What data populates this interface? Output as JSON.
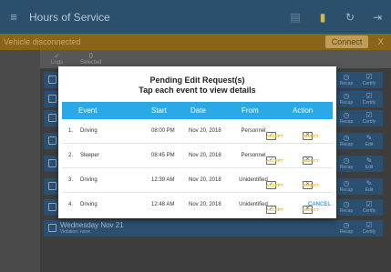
{
  "appbar": {
    "title": "Hours of Service",
    "menu_icon": "menu-icon"
  },
  "banner": {
    "text": "Vehicle disconnected",
    "connect_label": "Connect",
    "close_label": "X"
  },
  "toolbar": {
    "items": [
      {
        "icon": "✓",
        "label": "Logs"
      },
      {
        "icon": "0",
        "label": "Selected"
      }
    ]
  },
  "days": [
    {
      "title": "Wednesday Nov 21",
      "violation": "Violation: none"
    }
  ],
  "row_buttons": {
    "recap": "Recap",
    "certify": "Certify",
    "edit": "Edit"
  },
  "modal": {
    "title": "Pending Edit Request(s)",
    "subtitle": "Tap each event to view details",
    "columns": [
      "Event",
      "Start",
      "Date",
      "From",
      "Action"
    ],
    "rows": [
      {
        "num": "1.",
        "event": "Driving",
        "start": "08:00 PM",
        "date": "Nov 20, 2018",
        "from": "Personnel"
      },
      {
        "num": "2.",
        "event": "Sleeper",
        "start": "08:45 PM",
        "date": "Nov 20, 2018",
        "from": "Personnel"
      },
      {
        "num": "3.",
        "event": "Driving",
        "start": "12:39 AM",
        "date": "Nov 20, 2018",
        "from": "Unidentified"
      },
      {
        "num": "4.",
        "event": "Driving",
        "start": "12:48 AM",
        "date": "Nov 20, 2018",
        "from": "Unidentified"
      }
    ],
    "accept_label": "ACCEPT",
    "reject_label": "REJECT",
    "cancel_label": "CANCEL"
  },
  "colors": {
    "appbar": "#2c4f6c",
    "banner": "#8a6418",
    "header": "#29a9e6",
    "action": "#e3b518",
    "cancel": "#29a9e6"
  }
}
